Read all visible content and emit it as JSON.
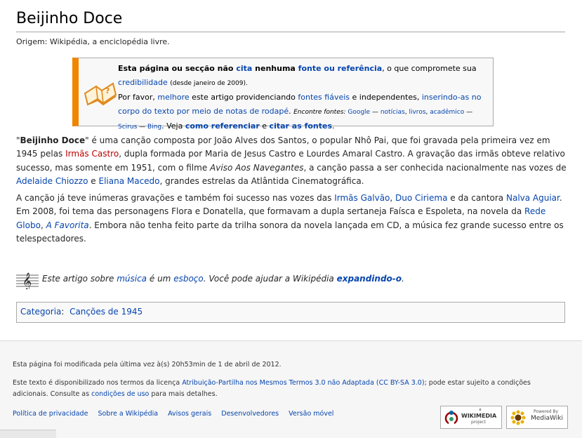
{
  "title": "Beijinho Doce",
  "origin": "Origem: Wikipédia, a enciclopédia livre.",
  "ambox": {
    "l1_b1": "Esta página ou secção não",
    "l1_cita": "cita",
    "l1_b2": "nenhuma",
    "l1_fonte": "fonte ou referência",
    "l1_rest": ", o que compromete sua",
    "l2_cred": "credibilidade",
    "l2_date": "(desde janeiro de 2009).",
    "l3_pre": "Por favor,",
    "l3_melhore": "melhore",
    "l3_mid": "este artigo providenciando",
    "l3_fontes": "fontes fiáveis",
    "l3_mid2": "e independentes,",
    "l3_ins": "inserindo-as no corpo do texto por meio de notas de rodapé",
    "l4_encontre": "Encontre fontes:",
    "l4_google": "Google",
    "l4_dash1": "—",
    "l4_noticias": "notícias",
    "l4_livros": "livros",
    "l4_academico": "acadêmico",
    "l4_dash2": "—",
    "l5_scirus": "Scirus",
    "l5_dash": "—",
    "l5_bing": "Bing",
    "l5_veja": ". Veja",
    "l5_como": "como referenciar",
    "l5_e": "e",
    "l5_citar": "citar as fontes"
  },
  "p1": {
    "bold": "Beijinho Doce",
    "t1": "é uma canção composta por João Alves dos Santos, o popular Nhô Pai, que foi gravada pela primeira vez em 1945 pelas",
    "l1": "Irmãs Castro",
    "t2": ", dupla formada por Maria de Jesus Castro e Lourdes Amaral Castro. A gravação das irmãs obteve relativo sucesso, mas somente em 1951, com o filme",
    "i1": "Aviso Aos Navegantes",
    "t3": ", a canção passa a ser conhecida nacionalmente nas vozes de",
    "l2": "Adelaide Chiozzo",
    "t4": "e",
    "l3": "Eliana Macedo",
    "t5": ", grandes estrelas da Atlântida Cinematográfica."
  },
  "p2": {
    "t1": "A canção já teve inúmeras gravações e também foi sucesso nas vozes das",
    "l1": "Irmãs Galvão",
    "l2": "Duo Ciriema",
    "t2": "e da cantora",
    "l3": "Nalva Aguiar",
    "t3": ". Em 2008, foi tema das personagens Flora e Donatella, que formavam a dupla sertaneja Faísca e Espoleta, na novela da",
    "l4": "Rede Globo",
    "l5": "A Favorita",
    "t4": ". Embora não tenha feito parte da trilha sonora da novela lançada em CD, a música fez grande sucesso entre os telespectadores."
  },
  "stub": {
    "t1": "Este artigo sobre",
    "l1": "música",
    "t2": "é um",
    "l2": "esboço",
    "t3": ". Você pode ajudar a Wikipédia",
    "l3": "expandindo-o",
    "t4": "."
  },
  "category": {
    "label": "Categoria",
    "item": "Canções de 1945"
  },
  "footer": {
    "modified": "Esta página foi modificada pela última vez à(s) 20h53min de 1 de abril de 2012.",
    "license_pre": "Este texto é disponibilizado nos termos da licença",
    "license_link": "Atribuição-Partilha nos Mesmos Termos 3.0 não Adaptada (CC BY-SA 3.0)",
    "license_post": "; pode estar sujeito a condições",
    "license_line2_pre": "adicionais. Consulte as",
    "license_terms": "condições de uso",
    "license_line2_post": "para mais detalhes.",
    "links": [
      "Política de privacidade",
      "Sobre a Wikipédia",
      "Avisos gerais",
      "Desenvolvedores",
      "Versão móvel"
    ],
    "wikimedia": {
      "top": "a",
      "main": "WIKIMEDIA",
      "bottom": "project"
    },
    "mediawiki": {
      "top": "Powered By",
      "main": "MediaWiki"
    }
  }
}
